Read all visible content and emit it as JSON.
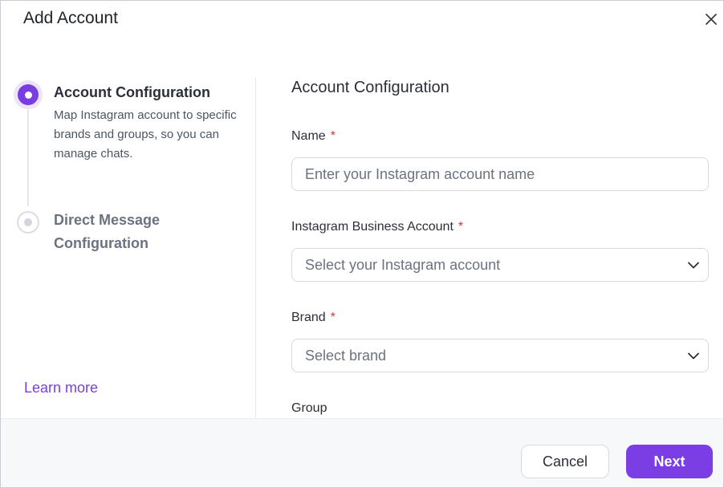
{
  "dialog": {
    "title": "Add Account"
  },
  "stepper": {
    "steps": [
      {
        "title": "Account Configuration",
        "description": "Map Instagram account to specific brands and groups, so you can manage chats.",
        "state": "active"
      },
      {
        "title": "Direct Message Configuration",
        "state": "inactive"
      }
    ],
    "learn_more": "Learn more"
  },
  "form": {
    "heading": "Account Configuration",
    "name": {
      "label": "Name",
      "required": "*",
      "placeholder": "Enter your Instagram account name",
      "value": ""
    },
    "instagram_business_account": {
      "label": "Instagram Business Account",
      "required": "*",
      "placeholder": "Select your Instagram account"
    },
    "brand": {
      "label": "Brand",
      "required": "*",
      "placeholder": "Select brand"
    },
    "group": {
      "label": "Group"
    }
  },
  "footer": {
    "cancel_label": "Cancel",
    "next_label": "Next"
  },
  "colors": {
    "accent": "#7b3ee5",
    "required": "#d93636",
    "link": "#7a3ee0"
  },
  "icons": {
    "close": "close-icon",
    "chevron": "chevron-down-icon"
  }
}
